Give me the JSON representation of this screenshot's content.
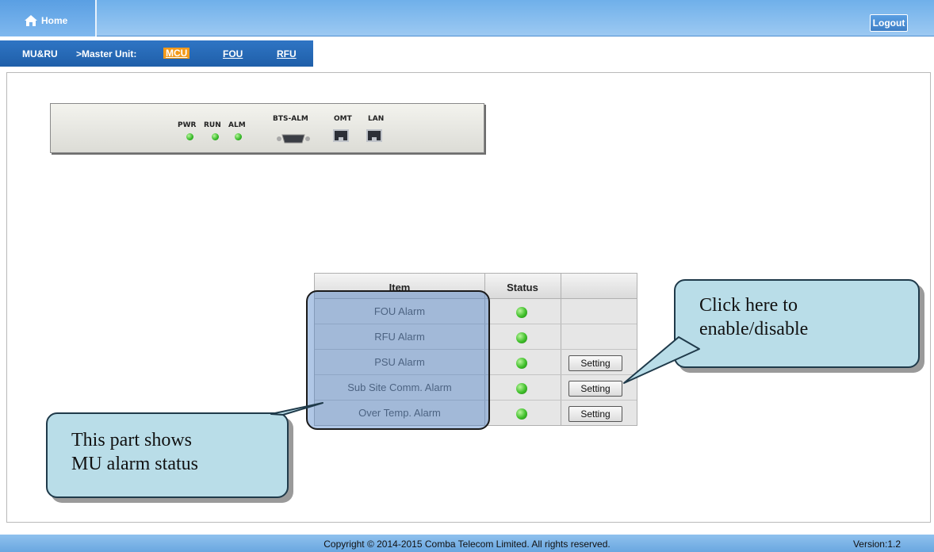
{
  "header": {
    "home_label": "Home",
    "logout_label": "Logout"
  },
  "nav": {
    "root": "MU&RU",
    "master_unit": ">Master Unit:",
    "tabs": [
      {
        "label": "MCU",
        "active": true
      },
      {
        "label": "FOU",
        "active": false
      },
      {
        "label": "RFU",
        "active": false
      }
    ]
  },
  "device_panel": {
    "labels": {
      "pwr": "PWR",
      "run": "RUN",
      "alm": "ALM",
      "bts_alm": "BTS-ALM",
      "omt": "OMT",
      "lan": "LAN"
    }
  },
  "alarm_table": {
    "headers": {
      "item": "Item",
      "status": "Status",
      "action": ""
    },
    "rows": [
      {
        "item": "FOU Alarm",
        "status": "green",
        "setting": null
      },
      {
        "item": "RFU Alarm",
        "status": "green",
        "setting": null
      },
      {
        "item": "PSU Alarm",
        "status": "green",
        "setting": "Setting"
      },
      {
        "item": "Sub Site Comm. Alarm",
        "status": "green",
        "setting": "Setting"
      },
      {
        "item": "Over Temp. Alarm",
        "status": "green",
        "setting": "Setting"
      }
    ]
  },
  "callouts": {
    "right_line1": "Click here to",
    "right_line2": "enable/disable",
    "left_line1": "This part shows",
    "left_line2": "MU alarm status"
  },
  "footer": {
    "copyright": "Copyright © 2014-2015 Comba Telecom Limited. All rights reserved.",
    "version": "Version:1.2"
  },
  "colors": {
    "header_blue": "#6fb0ea",
    "nav_blue": "#2f75c4",
    "active_tab": "#f39a1a",
    "led_green": "#3fbf2a",
    "callout_fill": "#b9dde8"
  }
}
